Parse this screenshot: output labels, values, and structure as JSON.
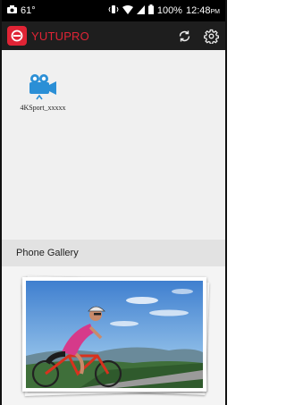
{
  "status_bar": {
    "battery_temp": "61°",
    "battery_level": "100%",
    "time": "12:48",
    "ampm": "PM",
    "icons": [
      "camera-icon",
      "vibrate-icon",
      "wifi-icon",
      "signal-icon",
      "battery-icon"
    ]
  },
  "app_bar": {
    "title": "YUTUPRO",
    "brand_color": "#e02435",
    "actions": [
      "refresh-icon",
      "settings-gear-icon"
    ]
  },
  "devices": [
    {
      "name": "4KSport_xxxxx",
      "icon": "video-camera-icon"
    }
  ],
  "gallery": {
    "header": "Phone Gallery",
    "thumbnail": "cyclist-photo-stack"
  }
}
